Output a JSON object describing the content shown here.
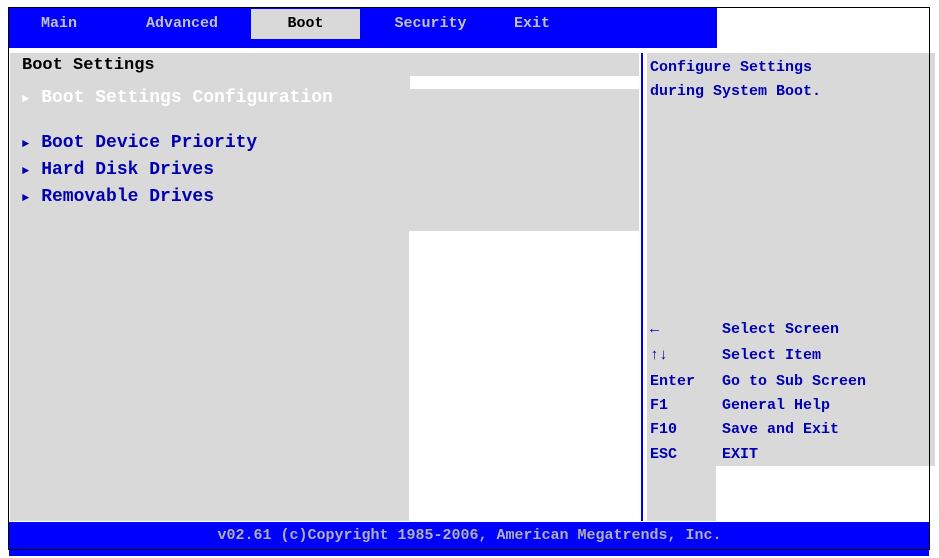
{
  "menu": {
    "tabs": [
      {
        "label": "Main",
        "active": false
      },
      {
        "label": "Advanced",
        "active": false
      },
      {
        "label": "Boot",
        "active": true
      },
      {
        "label": "Security",
        "active": false
      },
      {
        "label": "Exit",
        "active": false
      }
    ]
  },
  "main": {
    "title": "Boot Settings",
    "submenu_heading": "Boot Settings Configuration",
    "items": [
      {
        "label": "Boot Device Priority"
      },
      {
        "label": "Hard Disk Drives"
      },
      {
        "label": "Removable Drives"
      }
    ]
  },
  "help": {
    "lines": [
      "Configure Settings",
      "during System Boot."
    ],
    "keys": [
      {
        "key": "←",
        "action": "Select Screen",
        "icon": "left-arrow-icon"
      },
      {
        "key": "↑↓",
        "action": "Select Item",
        "icon": "up-down-arrows-icon"
      },
      {
        "key": "Enter",
        "action": "Go to Sub Screen"
      },
      {
        "key": "F1",
        "action": "General Help"
      },
      {
        "key": "F10",
        "action": "Save and Exit"
      },
      {
        "key": "ESC",
        "action": "EXIT"
      }
    ]
  },
  "footer": {
    "text": "v02.61 (c)Copyright 1985-2006, American Megatrends, Inc."
  },
  "colors": {
    "bios_blue": "#0000ff",
    "panel_grey": "#d9d9d9",
    "item_text": "#0000b0"
  }
}
